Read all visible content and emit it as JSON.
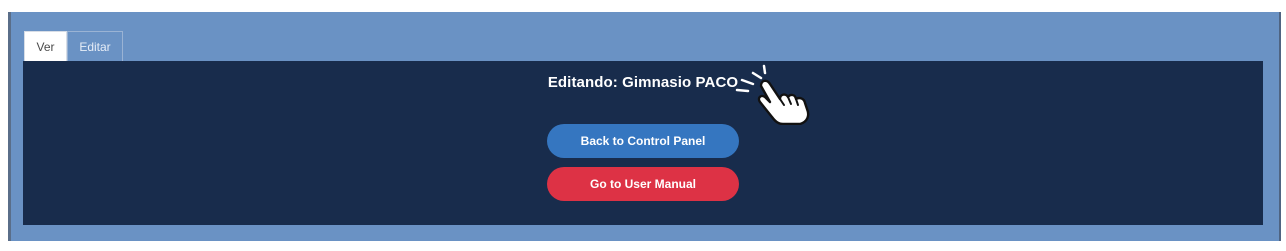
{
  "tabs": [
    {
      "label": "Ver"
    },
    {
      "label": "Editar"
    }
  ],
  "main": {
    "title": "Editando:  Gimnasio PACO"
  },
  "buttons": {
    "back_label": "Back to Control Panel",
    "manual_label": "Go to User Manual"
  },
  "colors": {
    "outer_panel": "#6a92c4",
    "content_bg": "#182c4c",
    "back_button": "#3576c0",
    "manual_button": "#dd3245"
  },
  "icons": {
    "cursor": "hand-pointer-icon"
  }
}
